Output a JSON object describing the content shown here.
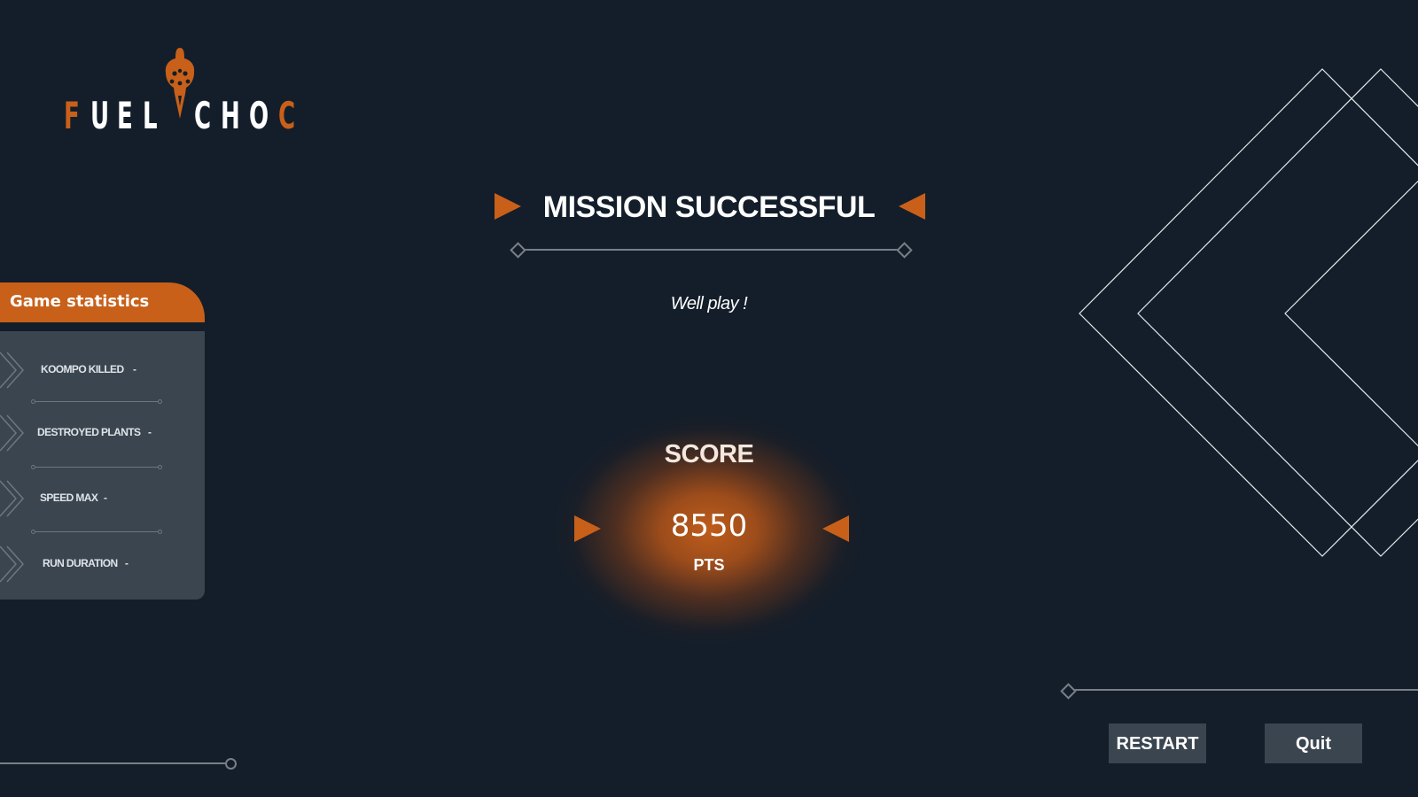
{
  "logo": {
    "letters": [
      "F",
      "U",
      "E",
      "L",
      "C",
      "H",
      "O",
      "C"
    ]
  },
  "title": "MISSION SUCCESSFUL",
  "subtitle": "Well play !",
  "score": {
    "label": "SCORE",
    "value": "8550",
    "unit": "PTS"
  },
  "stats": {
    "header": "Game statistics",
    "items": [
      {
        "label": "KOOMPO KILLED",
        "value": "-"
      },
      {
        "label": "DESTROYED PLANTS",
        "value": "-"
      },
      {
        "label": "SPEED MAX",
        "value": "-"
      },
      {
        "label": "RUN DURATION",
        "value": "-"
      }
    ]
  },
  "buttons": {
    "restart": "RESTART",
    "quit": "Quit"
  },
  "colors": {
    "background": "#131e2a",
    "accent": "#c8601a",
    "panel": "#3a4550",
    "line": "#7a7f86"
  },
  "icons": {
    "logo_mark": "rocket-skull-icon",
    "title_markers": "triangle-arrow-icon",
    "stat_markers": "double-chevron-icon",
    "decoration": "diamond-outline-decoration"
  }
}
